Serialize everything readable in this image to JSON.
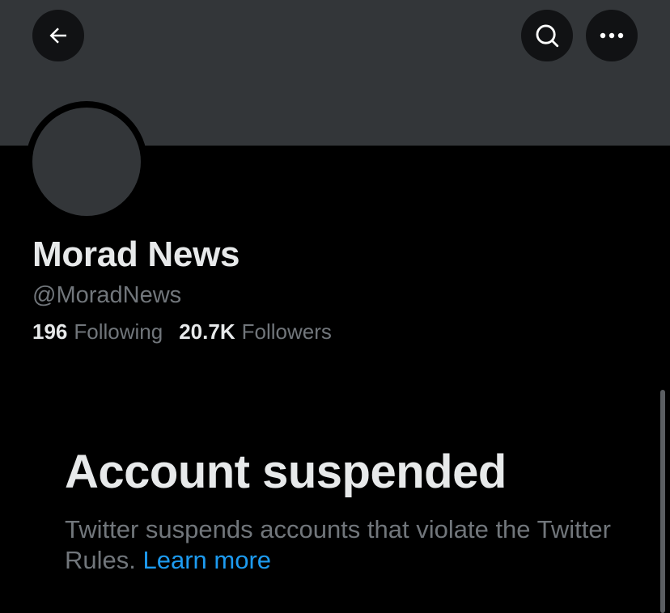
{
  "header": {
    "back_icon": "arrow-left-icon",
    "search_icon": "search-icon",
    "more_icon": "more-horizontal-icon",
    "banner_color": "#333639"
  },
  "profile": {
    "display_name": "Morad News",
    "handle": "@MoradNews",
    "following_count": "196",
    "following_label": "Following",
    "followers_count": "20.7K",
    "followers_label": "Followers"
  },
  "suspension": {
    "title": "Account suspended",
    "message": "Twitter suspends accounts that violate the Twitter Rules.",
    "link_label": "Learn more",
    "link_color": "#1d9bf0"
  }
}
